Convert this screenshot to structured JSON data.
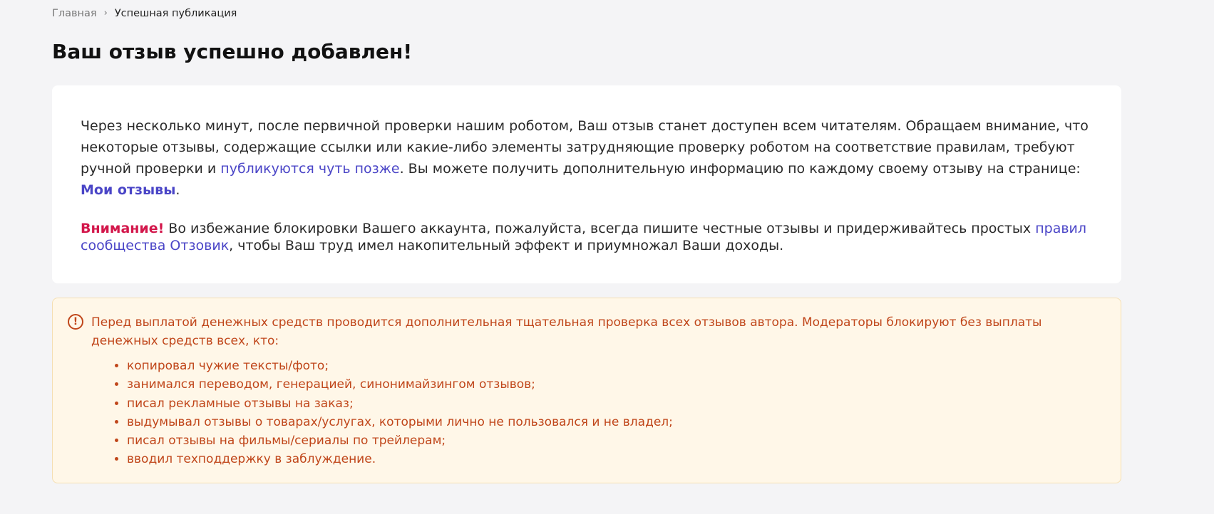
{
  "breadcrumb": {
    "home": "Главная",
    "separator": "›",
    "current": "Успешная публикация"
  },
  "page_title": "Ваш отзыв успешно добавлен!",
  "card": {
    "p1_text1": "Через несколько минут, после первичной проверки нашим роботом, Ваш отзыв станет доступен всем читателям. Обращаем внимание, что некоторые отзывы, содержащие ссылки или какие-либо элементы затрудняющие проверку роботом на соответствие правилам, требуют ручной проверки и ",
    "p1_link1": "публикуются чуть позже",
    "p1_text2": ". Вы можете получить дополнительную информацию по каждому своему отзыву на странице: ",
    "p1_link2": "Мои отзывы",
    "p1_text3": ".",
    "p2_attention": "Внимание!",
    "p2_text1": " Во избежание блокировки Вашего аккаунта, пожалуйста, всегда пишите честные отзывы и придерживайтесь простых ",
    "p2_link": "правил сообщества Отзовик",
    "p2_text2": ", чтобы Ваш труд имел накопительный эффект и приумножал Ваши доходы."
  },
  "warning": {
    "icon": "exclamation-circle-icon",
    "icon_glyph": "!",
    "text": "Перед выплатой денежных средств проводится дополнительная тщательная проверка всех отзывов автора. Модераторы блокируют без выплаты денежных средств всех, кто:",
    "items": [
      "копировал чужие тексты/фото;",
      "занимался переводом, генерацией, синонимайзингом отзывов;",
      "писал рекламные отзывы на заказ;",
      "выдумывал отзывы о товарах/услугах, которыми лично не пользовался и не владел;",
      "писал отзывы на фильмы/сериалы по трейлерам;",
      "вводил техподдержку в заблуждение."
    ]
  },
  "colors": {
    "background": "#f4f4f6",
    "link": "#4a45c7",
    "attention": "#d3174b",
    "warning_text": "#c0461a",
    "warning_bg": "#fff7e8"
  }
}
